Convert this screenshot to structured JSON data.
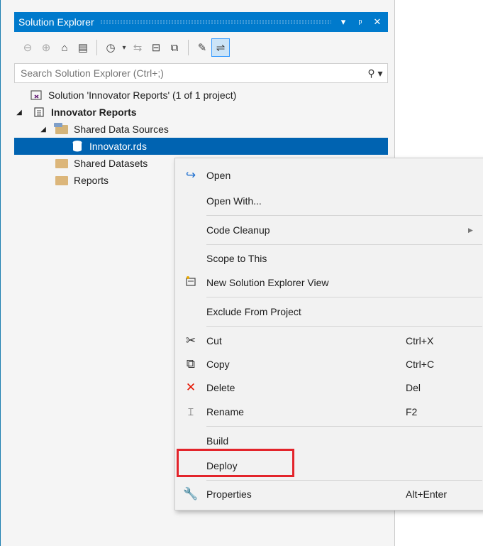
{
  "panel": {
    "title": "Solution Explorer",
    "title_buttons": [
      "▾",
      "⊥",
      "✕"
    ]
  },
  "toolbar": {
    "icons": [
      "back-icon",
      "forward-icon",
      "home-icon",
      "switch-views-icon",
      "pending-changes-filter-icon",
      "sync-icon",
      "collapse-all-icon",
      "show-all-files-icon",
      "properties-icon",
      "preview-icon"
    ]
  },
  "search": {
    "placeholder": "Search Solution Explorer (Ctrl+;)"
  },
  "tree": {
    "solution": "Solution 'Innovator Reports' (1 of 1 project)",
    "project": "Innovator Reports",
    "shared_data_sources": "Shared Data Sources",
    "selected_item": "Innovator.rds",
    "shared_datasets": "Shared Datasets",
    "reports": "Reports"
  },
  "context_menu": {
    "open": "Open",
    "open_with": "Open With...",
    "code_cleanup": "Code Cleanup",
    "scope_to_this": "Scope to This",
    "new_view": "New Solution Explorer View",
    "exclude": "Exclude From Project",
    "cut": "Cut",
    "cut_key": "Ctrl+X",
    "copy": "Copy",
    "copy_key": "Ctrl+C",
    "delete": "Delete",
    "delete_key": "Del",
    "rename": "Rename",
    "rename_key": "F2",
    "build": "Build",
    "deploy": "Deploy",
    "properties": "Properties",
    "properties_key": "Alt+Enter"
  },
  "colors": {
    "accent": "#007acc",
    "selection": "#0063b1",
    "highlight_box": "#e3242b"
  }
}
